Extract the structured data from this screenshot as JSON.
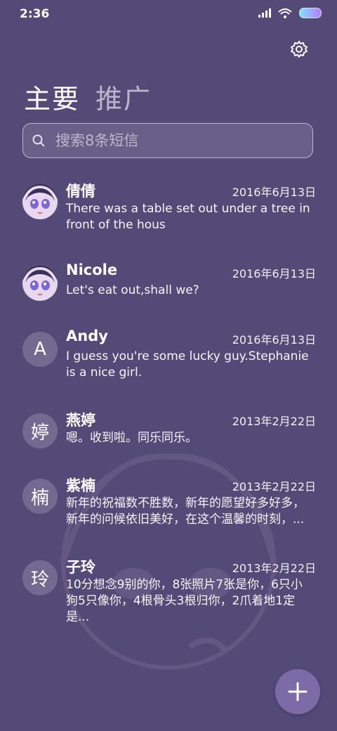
{
  "status_bar": {
    "time": "2:36"
  },
  "tabs": {
    "primary": "主要",
    "promotions": "推广"
  },
  "search": {
    "placeholder": "搜索8条短信"
  },
  "conversations": [
    {
      "name": "倩倩",
      "date": "2016年6月13日",
      "preview": "There was a table set out under a tree in front of the hous",
      "avatar": "anime-avatar"
    },
    {
      "name": "Nicole",
      "date": "2016年6月13日",
      "preview": "Let's eat out,shall we?",
      "avatar": "anime-avatar"
    },
    {
      "name": "Andy",
      "date": "2016年6月13日",
      "preview": "I guess you're some lucky guy.Stephanie is a nice girl.",
      "avatar_letter": "A"
    },
    {
      "name": "燕婷",
      "date": "2013年2月22日",
      "preview": "嗯。收到啦。同乐同乐。",
      "avatar_letter": "婷"
    },
    {
      "name": "紫楠",
      "date": "2013年2月22日",
      "preview": "新年的祝福数不胜数，新年的愿望好多好多，新年的问候依旧美好，在这个温馨的时刻，...",
      "avatar_letter": "楠"
    },
    {
      "name": "子玲",
      "date": "2013年2月22日",
      "preview": "10分想念9别的你，8张照片7张是你，6只小狗5只像你，4根骨头3根归你，2爪着地1定是...",
      "avatar_letter": "玲"
    }
  ],
  "icons": {
    "settings": "gear-icon",
    "search": "search-icon",
    "fab": "plus-icon"
  },
  "colors": {
    "background": "#544a78",
    "fab": "#7d6ba8"
  }
}
